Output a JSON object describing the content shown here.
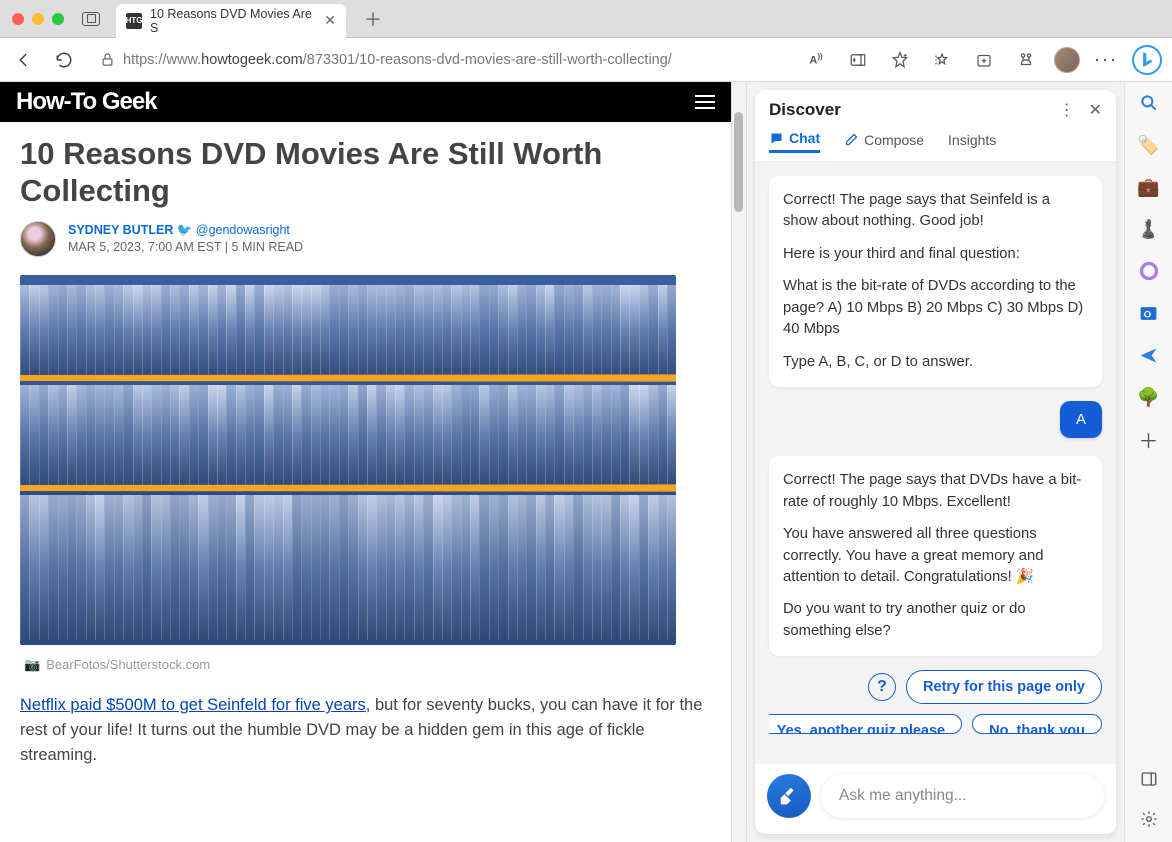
{
  "window": {
    "tab_title": "10 Reasons DVD Movies Are S",
    "favicon_text": "HTG"
  },
  "url": {
    "protocol_host": "https://www.",
    "domain": "howtogeek.com",
    "path": "/873301/10-reasons-dvd-movies-are-still-worth-collecting/"
  },
  "site": {
    "logo": "How-To Geek"
  },
  "article": {
    "title": "10 Reasons DVD Movies Are Still Worth Collecting",
    "author": "SYDNEY BUTLER",
    "handle": "@gendowasright",
    "meta": "MAR 5, 2023, 7:00 AM EST | 5 MIN READ",
    "credit": "BearFotos/Shutterstock.com",
    "link_text": "Netflix paid $500M to get Seinfeld for five years",
    "body_rest": ", but for seventy bucks, you can have it for the rest of your life! It turns out the humble DVD may be a hidden gem in this age of fickle streaming."
  },
  "chat": {
    "header": "Discover",
    "tabs": {
      "chat": "Chat",
      "compose": "Compose",
      "insights": "Insights"
    },
    "msg1": {
      "p1": "Correct! The page says that Seinfeld is a show about nothing. Good job!",
      "p2": "Here is your third and final question:",
      "p3": "What is the bit-rate of DVDs according to the page? A) 10 Mbps B) 20 Mbps C) 30 Mbps D) 40 Mbps",
      "p4": "Type A, B, C, or D to answer."
    },
    "user": "A",
    "msg2": {
      "p1": "Correct! The page says that DVDs have a bit-rate of roughly 10 Mbps. Excellent!",
      "p2": "You have answered all three questions correctly. You have a great memory and attention to detail. Congratulations! 🎉",
      "p3": "Do you want to try another quiz or do something else?"
    },
    "retry": "Retry for this page only",
    "sug1": "Yes, another quiz please",
    "sug2": "No, thank you",
    "placeholder": "Ask me anything..."
  }
}
